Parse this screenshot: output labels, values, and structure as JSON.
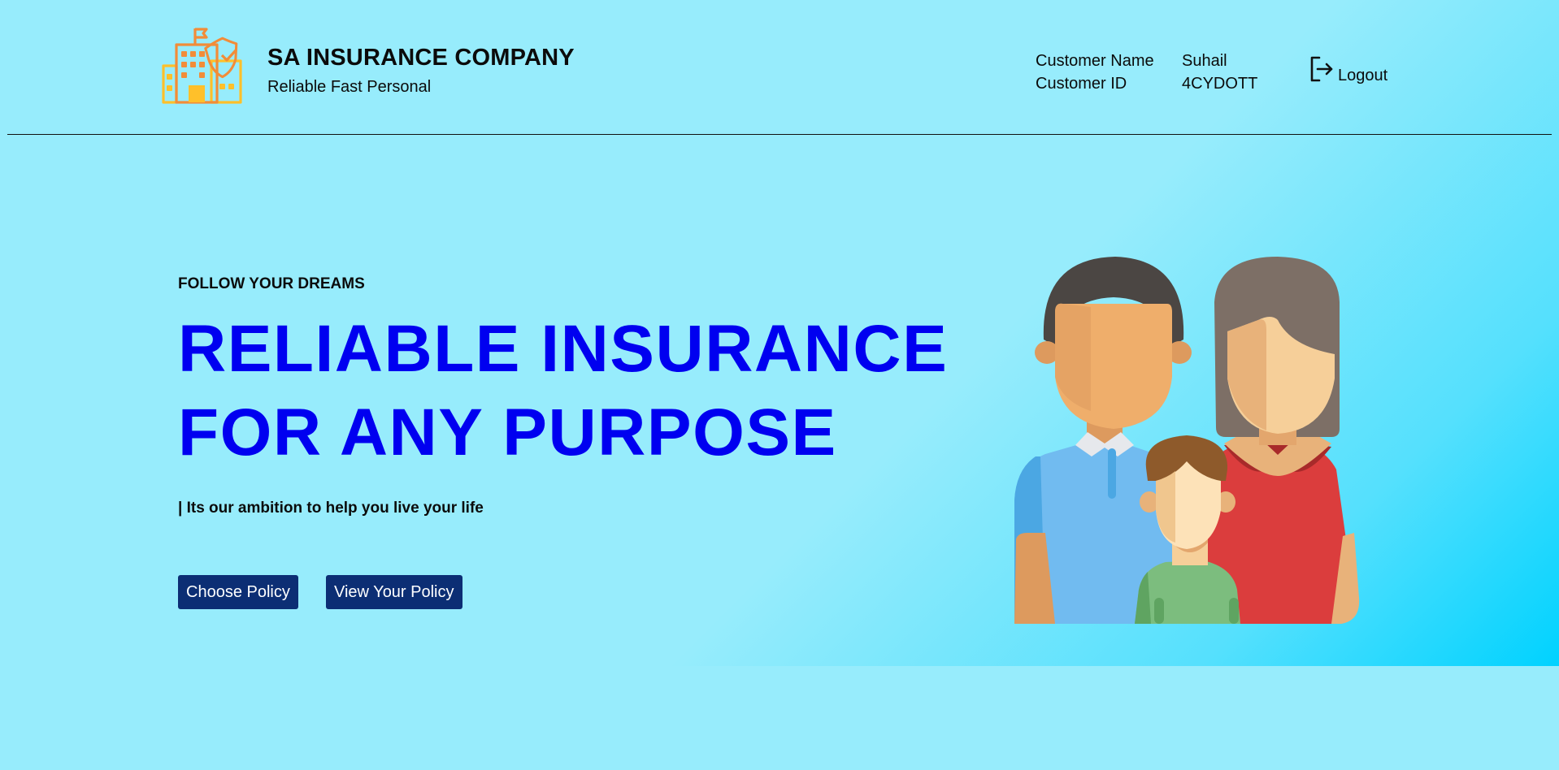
{
  "company": {
    "name": "SA INSURANCE COMPANY",
    "tagline": "Reliable Fast Personal"
  },
  "customer": {
    "name_label": "Customer Name",
    "name_value": "Suhail",
    "id_label": "Customer ID",
    "id_value": "4CYDOTT"
  },
  "logout": {
    "label": "Logout",
    "icon": "logout-icon"
  },
  "hero": {
    "kicker": "FOLLOW YOUR DREAMS",
    "headline_line1": "RELIABLE INSURANCE",
    "headline_line2": "FOR ANY PURPOSE",
    "subline": "| Its our ambition to help you live your life",
    "buttons": {
      "choose_policy": "Choose Policy",
      "view_policy": "View Your Policy"
    },
    "illustration": "family-illustration"
  },
  "colors": {
    "background": "#97ecfc",
    "headline": "#0000f0",
    "button_bg": "#0c2e74",
    "button_text": "#ffffff",
    "logo_orange": "#f28c38",
    "logo_yellow": "#ffc02a"
  }
}
